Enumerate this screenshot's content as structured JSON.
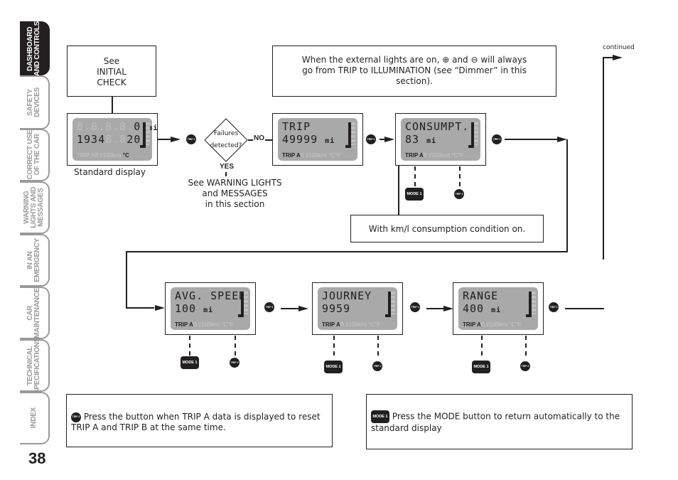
{
  "sidebar": {
    "tabs": [
      {
        "label": "DASHBOARD\nAND CONTROLS",
        "active": true
      },
      {
        "label": "SAFETY\nDEVICES",
        "active": false
      },
      {
        "label": "CORRECT USE\nOF THE CAR",
        "active": false
      },
      {
        "label": "WARNING\nLIGHTS AND\nMESSAGES",
        "active": false
      },
      {
        "label": "IN AN\nEMERGENCY",
        "active": false
      },
      {
        "label": "CAR\nMAINTENANCE",
        "active": false
      },
      {
        "label": "TECHNICAL\nSPECIFICATIONS",
        "active": false
      },
      {
        "label": "INDEX",
        "active": false
      }
    ],
    "page_number": "38"
  },
  "header": {
    "continued": "continued"
  },
  "notes": {
    "initial_check": "See\nINITIAL\nCHECK",
    "lights": "When the external lights are on, ⊕ and ⊖ will always go from TRIP to ILLUMINATION (see “Dimmer” in this section).",
    "standard_display": "Standard display",
    "failures": "Failures\ndetected?",
    "no": "NO",
    "yes": "YES",
    "warning": "See WARNING LIGHTS\nand MESSAGES\nin this section",
    "kml": "With km/l consumption condition on.",
    "trip2_note": "Press the button when TRIP A data is displayed to reset TRIP A and TRIP B at the same time.",
    "mode_note": "Press the MODE button to return automatically to the standard display"
  },
  "buttons": {
    "trip1": "TRIP 1",
    "trip2": "TRIP 2",
    "mode1": "MODE 1"
  },
  "displays": {
    "standard": {
      "line1": "0",
      "line1_unit": "mi",
      "line2_left": "1934",
      "line2_right": "20",
      "footer_lit": "",
      "footer_dim": "TRIP AB l/100kmi",
      "temp_unit": "°C"
    },
    "trip": {
      "line1": "TRIP",
      "line2": "49999",
      "unit": "mi",
      "footer_lit": "TRIP A",
      "footer_dim": "B l/100kmi °C°F"
    },
    "consumpt": {
      "line1": "CONSUMPT.",
      "line2": "83",
      "unit": "mi",
      "footer_lit": "TRIP A",
      "footer_dim": "B l/100kmi °C°F"
    },
    "avg_speed": {
      "line1": "AVG. SPEED",
      "line2": "100",
      "unit": "mi",
      "footer_lit": "TRIP A",
      "footer_dim": "B l/100kmi °C°F"
    },
    "journey": {
      "line1": "JOURNEY",
      "line2": "9959",
      "unit": "",
      "footer_lit": "TRIP A",
      "footer_dim": "B l/100kmi °C°F"
    },
    "range": {
      "line1": "RANGE",
      "line2": "400",
      "unit": "mi",
      "footer_lit": "TRIP A",
      "footer_dim": "B l/100kmi °C°F"
    }
  }
}
